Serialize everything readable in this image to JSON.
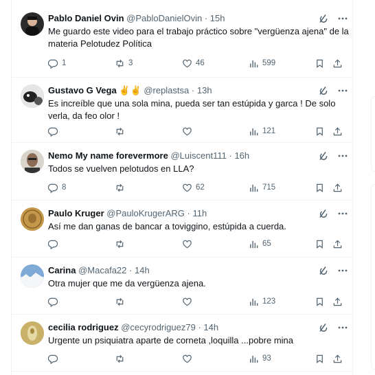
{
  "tweets": [
    {
      "name": "Pablo Daniel Ovin",
      "handle": "@PabloDanielOvin",
      "dot": "·",
      "time": "15h",
      "text": "Me guardo este video para el trabajo práctico sobre \"vergüenza ajena\" de la materia Pelotudez Política",
      "replies": "1",
      "retweets": "3",
      "likes": "46",
      "views": "599",
      "avatar_color": "#2b2b2b"
    },
    {
      "name": "Gustavo G Vega ✌️✌️",
      "handle": "@replastsa",
      "dot": "·",
      "time": "13h",
      "text": "Es increíble que una sola mina, pueda ser tan estúpida y garca ! De solo verla, da feo olor !",
      "replies": "",
      "retweets": "",
      "likes": "",
      "views": "121",
      "avatar_color": "#3a3a3a"
    },
    {
      "name": "Nemo My name forevermore",
      "handle": "@Luiscent111",
      "dot": "·",
      "time": "16h",
      "text": "Todos se vuelven pelotudos en LLA?",
      "replies": "8",
      "retweets": "",
      "likes": "62",
      "views": "715",
      "avatar_color": "#c9c2b6"
    },
    {
      "name": "Paulo Kruger",
      "handle": "@PauloKrugerARG",
      "dot": "·",
      "time": "11h",
      "text": "Así me dan ganas de bancar a toviggino, estúpida a cuerda.",
      "replies": "",
      "retweets": "",
      "likes": "",
      "views": "65",
      "avatar_color": "#b98a3e"
    },
    {
      "name": "Carina",
      "handle": "@Macafa22",
      "dot": "·",
      "time": "14h",
      "text": "Otra mujer que me da vergüenza ajena.",
      "replies": "",
      "retweets": "",
      "likes": "",
      "views": "123",
      "avatar_color": "#5b8fc4"
    },
    {
      "name": "cecilia rodriguez",
      "handle": "@cecyrodriguez79",
      "dot": "·",
      "time": "14h",
      "text": "Urgente un psiquiatra aparte de corneta ,loquilla ...pobre mina",
      "replies": "",
      "retweets": "",
      "likes": "",
      "views": "93",
      "avatar_color": "#b6a15a"
    }
  ],
  "colors": {
    "text": "#0f1419",
    "secondary": "#536471",
    "border": "#eff3f4"
  },
  "icons": [
    "grok-icon",
    "more-icon",
    "reply-icon",
    "retweet-icon",
    "like-icon",
    "views-icon",
    "bookmark-icon",
    "share-icon"
  ]
}
